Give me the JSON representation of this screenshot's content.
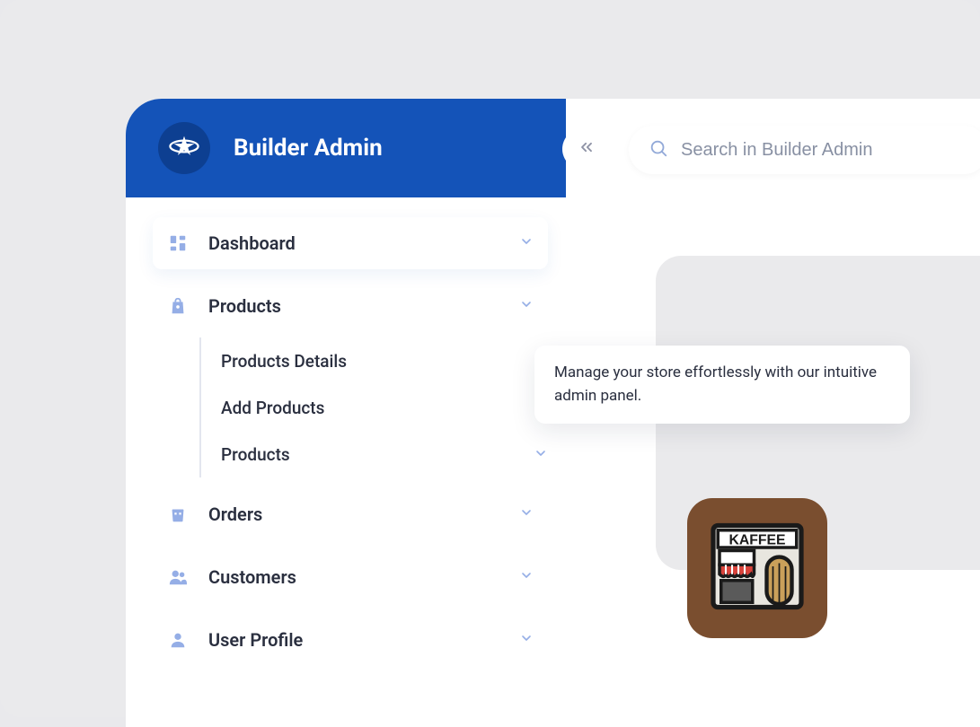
{
  "app": {
    "title": "Builder Admin"
  },
  "search": {
    "placeholder": "Search in Builder Admin"
  },
  "tooltip": {
    "text": "Manage your store effortlessly with our intuitive admin panel."
  },
  "sidebar": {
    "items": [
      {
        "icon": "dashboard-icon",
        "label": "Dashboard",
        "expandable": true,
        "active": true
      },
      {
        "icon": "bag-icon",
        "label": "Products",
        "expandable": true,
        "children": [
          {
            "label": "Products  Details",
            "expandable": false
          },
          {
            "label": "Add Products",
            "expandable": false
          },
          {
            "label": "Products",
            "expandable": true
          }
        ]
      },
      {
        "icon": "robot-icon",
        "label": "Orders",
        "expandable": true
      },
      {
        "icon": "users-icon",
        "label": "Customers",
        "expandable": true
      },
      {
        "icon": "user-icon",
        "label": "User Profile",
        "expandable": true
      }
    ]
  },
  "shop_card": {
    "label": "KAFFEE",
    "icon": "storefront-icon"
  },
  "colors": {
    "brand": "#1453b8",
    "accent_light": "#95aee6",
    "bg": "#eaeaec",
    "text": "#2a2f3f"
  }
}
